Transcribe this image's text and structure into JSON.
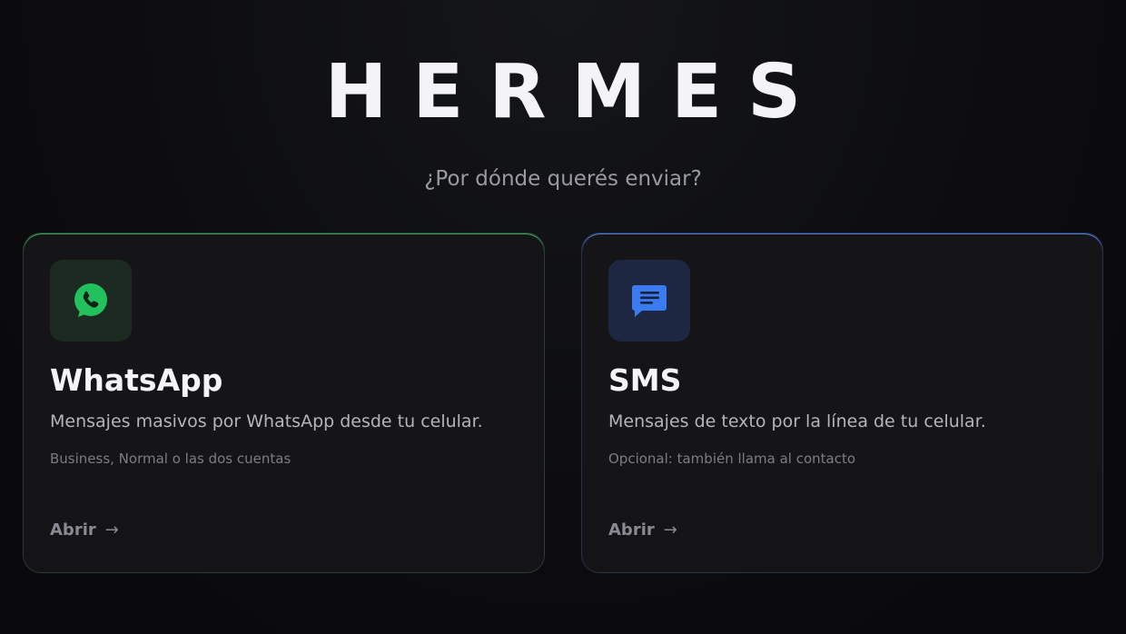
{
  "brand": {
    "title": "HERMES"
  },
  "prompt": {
    "text": "¿Por dónde querés enviar?"
  },
  "cards": [
    {
      "id": "whatsapp",
      "icon": "whatsapp-icon",
      "accent_color": "#2fa55a",
      "title": "WhatsApp",
      "description": "Mensajes masivos por WhatsApp desde tu celular.",
      "note": "Business, Normal o las dos cuentas",
      "action_label": "Abrir",
      "action_arrow": "→"
    },
    {
      "id": "sms",
      "icon": "message-icon",
      "accent_color": "#3b7bf0",
      "title": "SMS",
      "description": "Mensajes de texto por la línea de tu celular.",
      "note": "Opcional: también llama al contacto",
      "action_label": "Abrir",
      "action_arrow": "→"
    }
  ]
}
